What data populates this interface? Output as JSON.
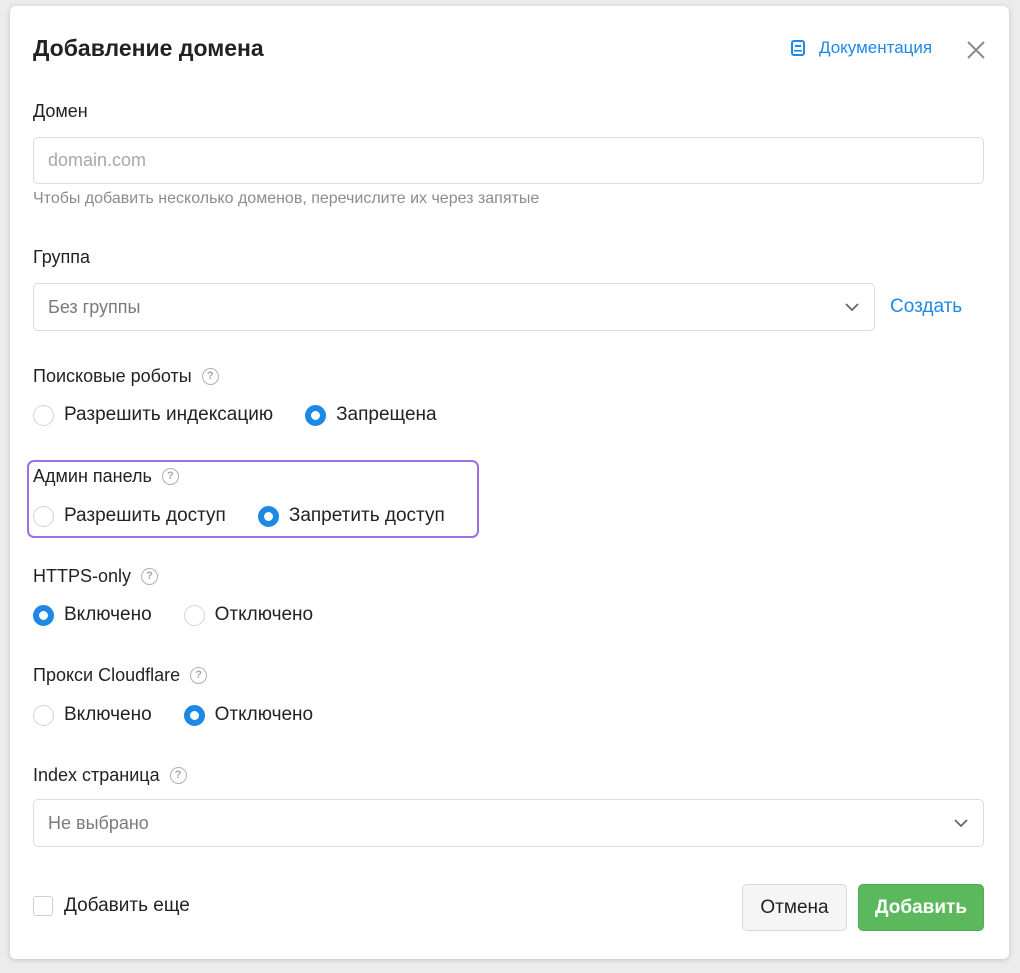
{
  "modal": {
    "title": "Добавление домена",
    "doc_link": "Документация",
    "close_icon": "close-icon"
  },
  "domain": {
    "label": "Домен",
    "placeholder": "domain.com",
    "value": "",
    "hint": "Чтобы добавить несколько доменов, перечислите их через запятые"
  },
  "group": {
    "label": "Группа",
    "selected": "Без группы",
    "create_link": "Создать"
  },
  "robots": {
    "label": "Поисковые роботы",
    "options": [
      "Разрешить индексацию",
      "Запрещена"
    ],
    "selected_index": 1
  },
  "admin_panel": {
    "label": "Админ панель",
    "options": [
      "Разрешить доступ",
      "Запретить доступ"
    ],
    "selected_index": 1
  },
  "https_only": {
    "label": "HTTPS-only",
    "options": [
      "Включено",
      "Отключено"
    ],
    "selected_index": 0
  },
  "cloudflare": {
    "label": "Прокси Cloudflare",
    "options": [
      "Включено",
      "Отключено"
    ],
    "selected_index": 1
  },
  "index_page": {
    "label": "Index страница",
    "selected": "Не выбрано"
  },
  "footer": {
    "add_more": "Добавить еще",
    "add_more_checked": false,
    "cancel": "Отмена",
    "submit": "Добавить"
  },
  "colors": {
    "accent": "#1e88e5",
    "success": "#5cb85c",
    "highlight": "#9f6fe8"
  }
}
